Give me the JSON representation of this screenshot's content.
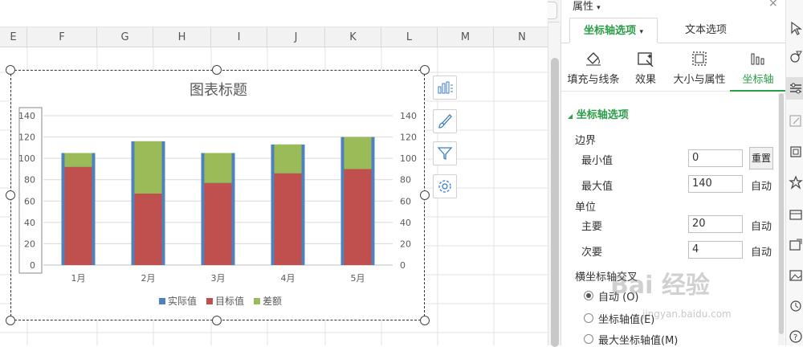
{
  "columns": [
    "E",
    "F",
    "G",
    "H",
    "I",
    "J",
    "K",
    "L",
    "M",
    "N"
  ],
  "chart_tools": [
    {
      "icon": "chart-elements-icon"
    },
    {
      "icon": "chart-style-brush-icon"
    },
    {
      "icon": "chart-filter-icon"
    },
    {
      "icon": "chart-settings-gear-icon"
    }
  ],
  "chart_data": {
    "type": "bar",
    "stacked": true,
    "title": "图表标题",
    "categories": [
      "1月",
      "2月",
      "3月",
      "4月",
      "5月"
    ],
    "series": [
      {
        "name": "实际值",
        "color": "#4f81bd",
        "values": [
          105,
          116,
          105,
          113,
          120
        ]
      },
      {
        "name": "目标值",
        "color": "#c0504d",
        "values": [
          92,
          67,
          77,
          86,
          90
        ]
      },
      {
        "name": "差额",
        "color": "#9bbb59",
        "values": [
          13,
          49,
          28,
          27,
          30
        ]
      }
    ],
    "ylim": [
      0,
      140
    ],
    "yticks": [
      0,
      20,
      40,
      60,
      80,
      100,
      120,
      140
    ],
    "secondary_axis": true,
    "legend": "bottom",
    "grid": true
  },
  "panel": {
    "title": "属性",
    "title_caret": "▾",
    "close": "×",
    "tabs": [
      {
        "label": "坐标轴选项",
        "caret": "▾",
        "active": true
      },
      {
        "label": "文本选项",
        "active": false
      }
    ],
    "subtabs": [
      {
        "label": "填充与线条",
        "icon": "fill-bucket-icon"
      },
      {
        "label": "效果",
        "icon": "effects-icon"
      },
      {
        "label": "大小与属性",
        "icon": "size-properties-icon"
      },
      {
        "label": "坐标轴",
        "icon": "axis-bars-icon",
        "active": true
      }
    ],
    "section": "坐标轴选项",
    "section_caret": "◢",
    "bounds_label": "边界",
    "min_label": "最小值",
    "min_value": "0",
    "reset_label": "重置",
    "max_label": "最大值",
    "max_value": "140",
    "auto_label": "自动",
    "unit_label": "单位",
    "major_label": "主要",
    "major_value": "20",
    "minor_label": "次要",
    "minor_value": "4",
    "cross_label": "横坐标轴交叉",
    "cross_options": [
      {
        "label": "自动 (O)",
        "selected": true
      },
      {
        "label": "坐标轴值(E)",
        "selected": false
      },
      {
        "label": "最大坐标轴值(M)",
        "selected": false
      }
    ]
  },
  "watermark": "Bai 经验",
  "watermark_url": "jingyan.baidu.com"
}
